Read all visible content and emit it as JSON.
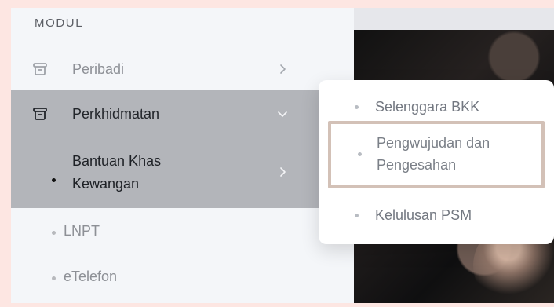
{
  "sidebar": {
    "section_title": "MODUL",
    "items": [
      {
        "label": "Peribadi",
        "icon": "archive-icon"
      },
      {
        "label": "Perkhidmatan",
        "icon": "archive-icon"
      },
      {
        "label": "Bantuan Khas Kewangan"
      },
      {
        "label": "LNPT"
      },
      {
        "label": "eTelefon"
      }
    ]
  },
  "submenu": {
    "items": [
      {
        "label": "Selenggara BKK"
      },
      {
        "label": "Pengwujudan dan Pengesahan"
      },
      {
        "label": "Kelulusan PSM"
      }
    ]
  },
  "colors": {
    "page_background": "#fde6e2",
    "sidebar_background": "#f4f6f9",
    "active_row_background": "#b3b5ba",
    "highlight_border": "#d3c1b7"
  }
}
